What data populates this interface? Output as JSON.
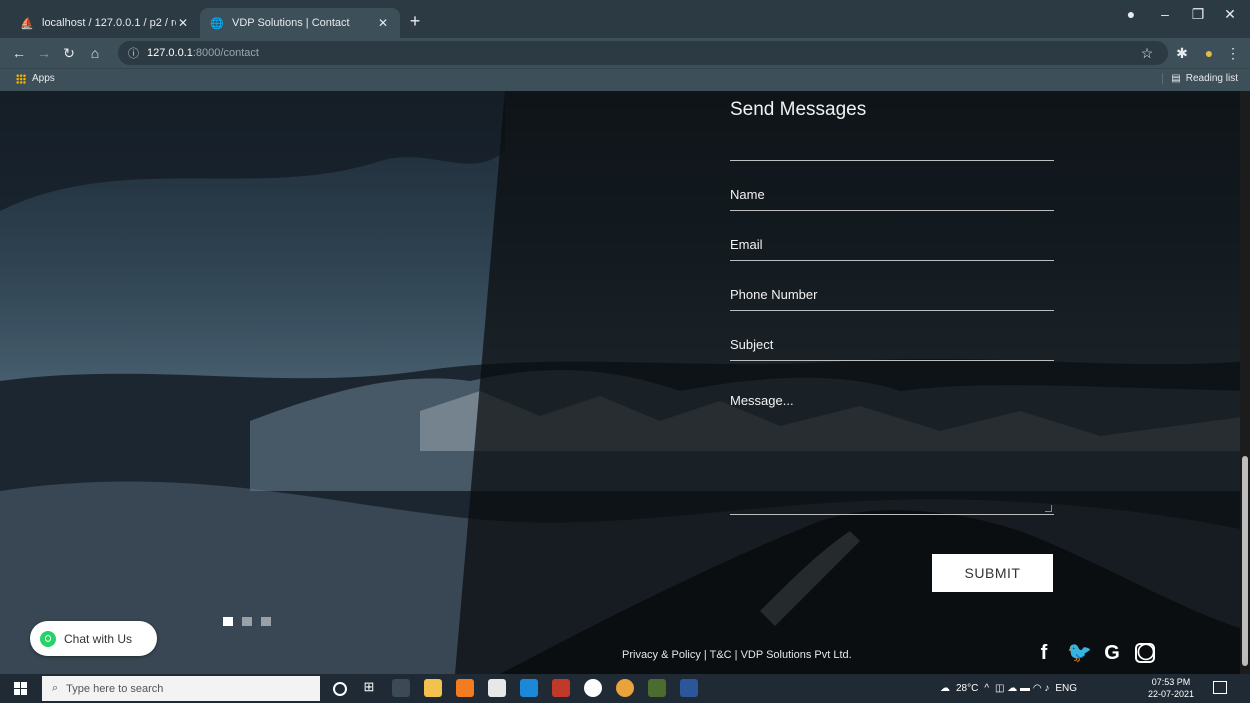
{
  "browser": {
    "tabs": [
      {
        "label": "localhost / 127.0.0.1 / p2 / reviev",
        "active": false
      },
      {
        "label": "VDP Solutions | Contact",
        "active": true
      }
    ],
    "address": {
      "host": "127.0.0.1",
      "path": ":8000/contact"
    },
    "bookmarks": {
      "apps_label": "Apps",
      "reading_list_label": "Reading list"
    }
  },
  "page": {
    "form": {
      "title": "Send Messages",
      "name_placeholder": "Name",
      "email_placeholder": "Email",
      "phone_placeholder": "Phone Number",
      "subject_placeholder": "Subject",
      "message_placeholder": "Message...",
      "submit_label": "SUBMIT"
    },
    "slider_dots": {
      "count": 3,
      "active_index": 0
    },
    "chat_label": "Chat with Us",
    "footer_text": "Privacy & Policy | T&C | VDP Solutions Pvt Ltd.",
    "social_icons": [
      "facebook-icon",
      "twitter-icon",
      "google-icon",
      "instagram-icon"
    ]
  },
  "taskbar": {
    "search_placeholder": "Type here to search",
    "weather": "28°C",
    "language": "ENG",
    "time": "07:53 PM",
    "date": "22-07-2021"
  }
}
